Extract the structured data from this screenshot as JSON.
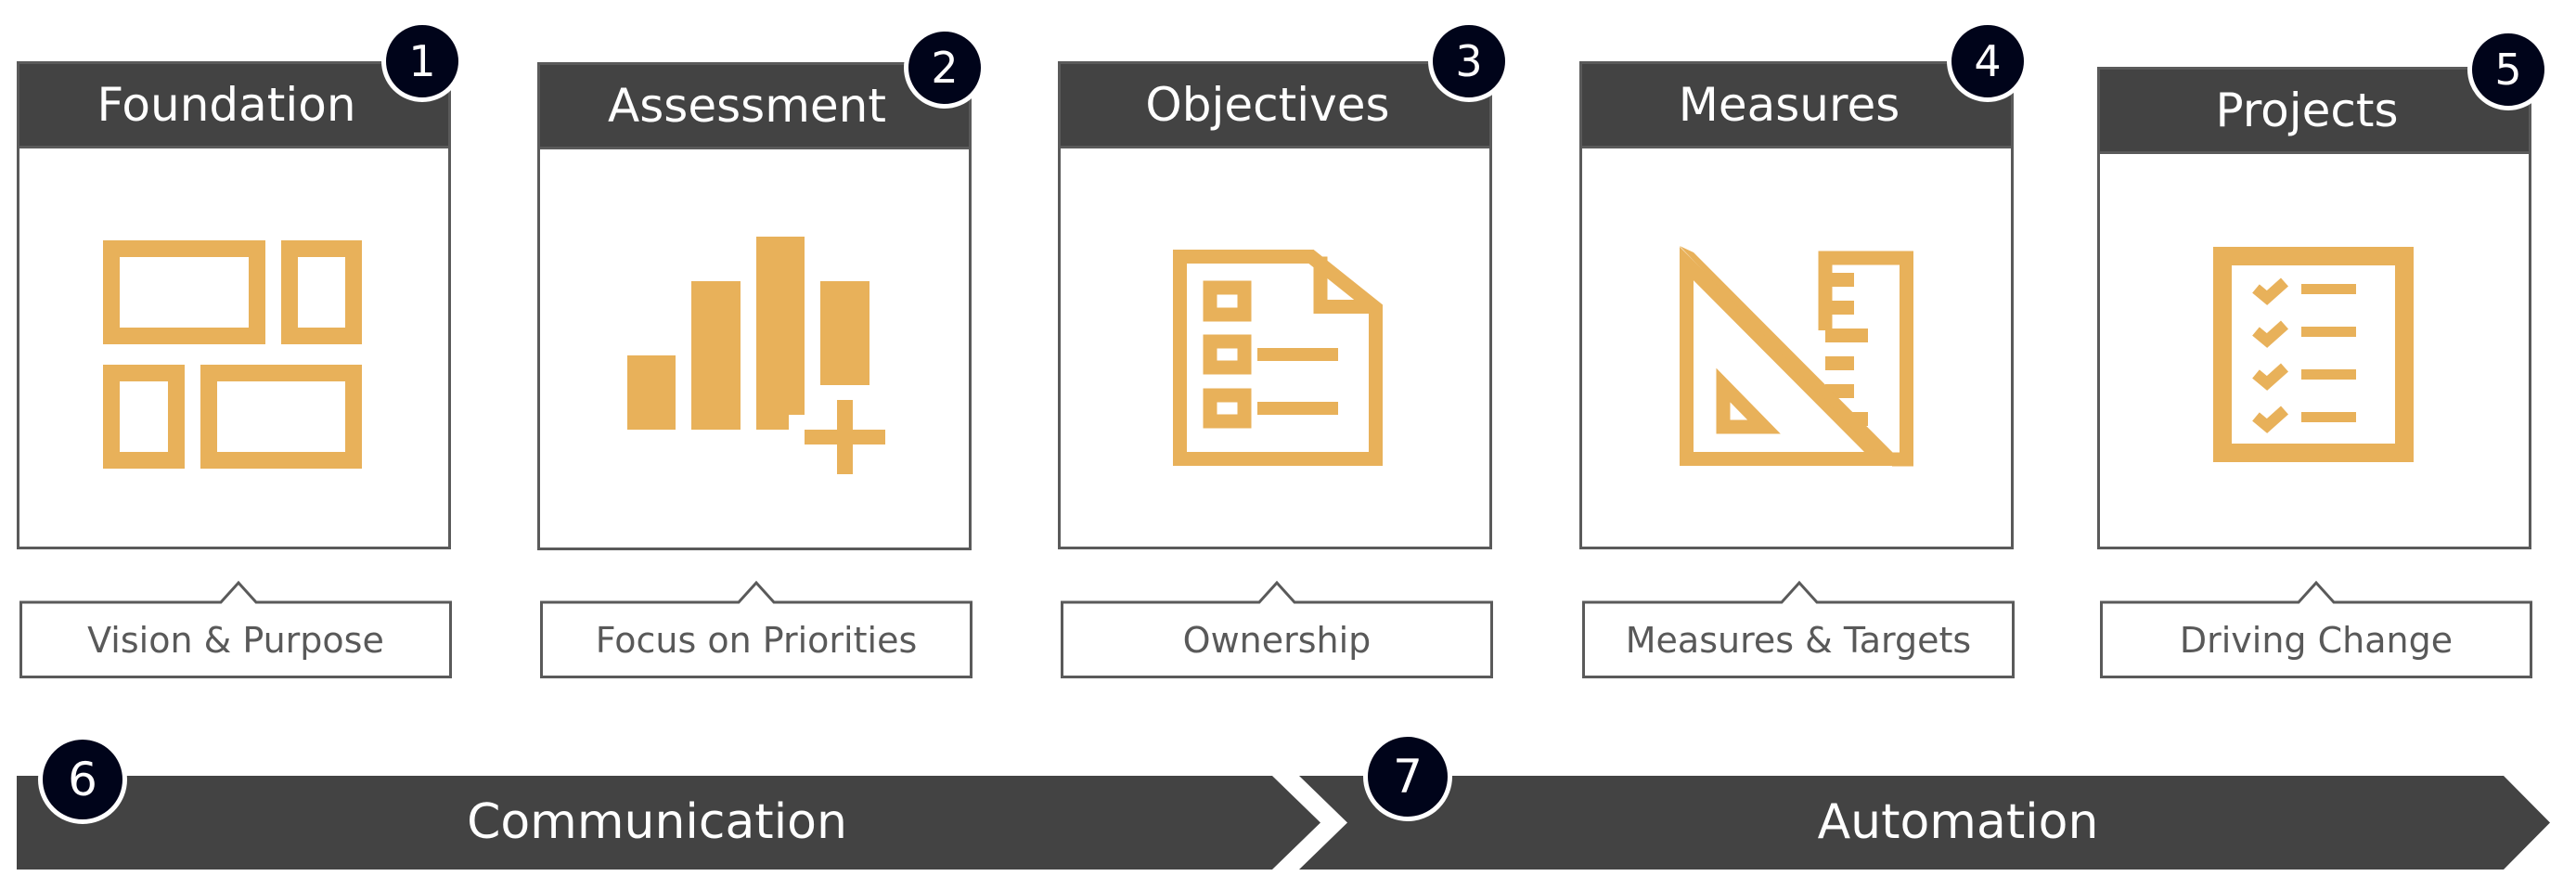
{
  "colors": {
    "header_bg": "#434343",
    "border": "#5a5a5a",
    "badge_bg": "#00041a",
    "icon_gold": "#E8B15A",
    "label_text": "#595959"
  },
  "steps": [
    {
      "number": "1",
      "title": "Foundation",
      "icon": "layout-grid-icon",
      "caption": "Vision & Purpose"
    },
    {
      "number": "2",
      "title": "Assessment",
      "icon": "bar-chart-plus-icon",
      "caption": "Focus on Priorities"
    },
    {
      "number": "3",
      "title": "Objectives",
      "icon": "checklist-document-icon",
      "caption": "Ownership"
    },
    {
      "number": "4",
      "title": "Measures",
      "icon": "ruler-triangle-icon",
      "caption": "Measures & Targets"
    },
    {
      "number": "5",
      "title": "Projects",
      "icon": "clipboard-checklist-icon",
      "caption": "Driving Change"
    }
  ],
  "bottom": [
    {
      "number": "6",
      "label": "Communication"
    },
    {
      "number": "7",
      "label": "Automation"
    }
  ]
}
